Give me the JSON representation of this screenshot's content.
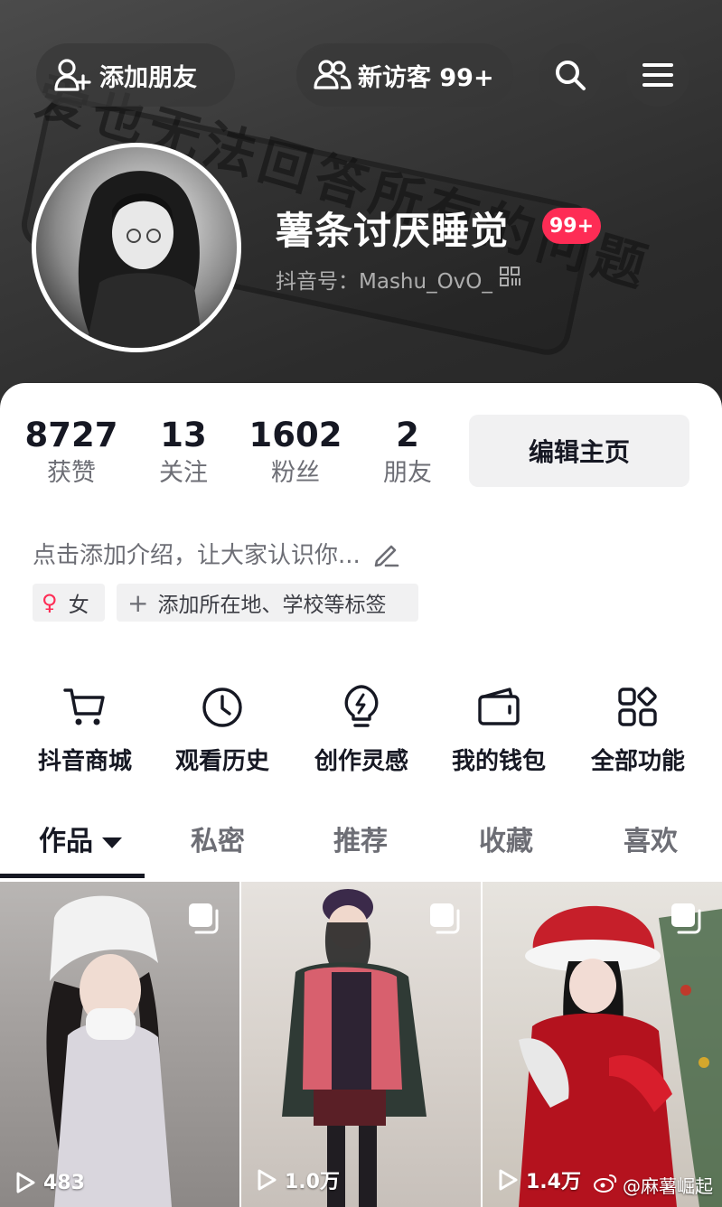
{
  "header": {
    "background_text": "爱也无法回答所有的问题",
    "add_friend_label": "添加朋友",
    "visitors_label": "新访客 99+",
    "nickname": "薯条讨厌睡觉",
    "notification_badge": "99+",
    "douyin_id": "抖音号：Mashu_OvO_"
  },
  "stats": [
    {
      "value": "8727",
      "label": "获赞"
    },
    {
      "value": "13",
      "label": "关注"
    },
    {
      "value": "1602",
      "label": "粉丝"
    },
    {
      "value": "2",
      "label": "朋友"
    }
  ],
  "edit_profile_label": "编辑主页",
  "bio_placeholder": "点击添加介绍，让大家认识你...",
  "tags": {
    "gender": "女",
    "add_tags": "添加所在地、学校等标签"
  },
  "quick_actions": [
    {
      "label": "抖音商城",
      "icon": "cart-icon"
    },
    {
      "label": "观看历史",
      "icon": "clock-icon"
    },
    {
      "label": "创作灵感",
      "icon": "lightbulb-icon"
    },
    {
      "label": "我的钱包",
      "icon": "wallet-icon"
    },
    {
      "label": "全部功能",
      "icon": "grid-icon"
    }
  ],
  "tabs": [
    {
      "label": "作品",
      "active": true
    },
    {
      "label": "私密",
      "active": false
    },
    {
      "label": "推荐",
      "active": false
    },
    {
      "label": "收藏",
      "active": false
    },
    {
      "label": "喜欢",
      "active": false
    }
  ],
  "videos": [
    {
      "play_count": "483"
    },
    {
      "play_count": "1.0万"
    },
    {
      "play_count": "1.4万"
    }
  ],
  "watermark": "@麻薯崛起",
  "colors": {
    "accent": "#fe2c55",
    "text_primary": "#161823",
    "text_secondary": "#6d6e75"
  }
}
